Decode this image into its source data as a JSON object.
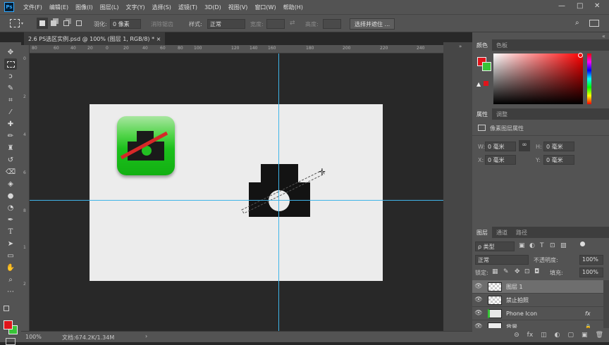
{
  "app": {
    "logo": "Ps"
  },
  "menu": [
    "文件(F)",
    "编辑(E)",
    "图像(I)",
    "图层(L)",
    "文字(Y)",
    "选择(S)",
    "滤镜(T)",
    "3D(D)",
    "视图(V)",
    "窗口(W)",
    "帮助(H)"
  ],
  "window_controls": {
    "minimize": "—",
    "maximize": "□",
    "close": "✕"
  },
  "options": {
    "feather_label": "羽化:",
    "feather_value": "0 像素",
    "antialias": "消除锯齿",
    "style_label": "样式:",
    "style_value": "正常",
    "width_label": "宽度:",
    "height_label": "高度:",
    "select_mask": "选择并遮住 ..."
  },
  "document": {
    "tab": "2.6 PS选区实例.psd @ 100% (图层 1, RGB/8) *",
    "close": "×"
  },
  "ruler_top": [
    "80",
    "60",
    "40",
    "20",
    "0",
    "20",
    "40",
    "60",
    "80",
    "100",
    "120",
    "140",
    "160",
    "180",
    "200",
    "220",
    "240"
  ],
  "ruler_left": [
    "0",
    "2",
    "4",
    "6",
    "8",
    "1",
    "2"
  ],
  "status": {
    "zoom": "100%",
    "doc": "文档:674.2K/1.34M",
    "arrow": "›"
  },
  "panels": {
    "color_tabs": [
      "颜色",
      "色板"
    ],
    "properties_tabs": [
      "属性",
      "调整"
    ],
    "properties_title": "像素图层属性",
    "w_label": "W:",
    "w_value": "0 毫米",
    "h_label": "H:",
    "h_value": "0 毫米",
    "x_label": "X:",
    "x_value": "0 毫米",
    "y_label": "Y:",
    "y_value": "0 毫米",
    "link_icon": "∞",
    "layers_tabs": [
      "图层",
      "通道",
      "路径"
    ],
    "filter_kind": "ρ 类型",
    "blend_mode": "正常",
    "opacity_label": "不透明度:",
    "opacity_value": "100%",
    "lock_label": "锁定:",
    "fill_label": "填充:",
    "fill_value": "100%",
    "layers": [
      {
        "name": "图层 1"
      },
      {
        "name": "禁止拍照"
      },
      {
        "name": "Phone Icon",
        "fx": "fx"
      },
      {
        "name": "背景",
        "lock": "🔒"
      }
    ],
    "bottom_icons": [
      "⊝",
      "fx",
      "◫",
      "◐",
      "▢",
      "▣",
      "🗑"
    ]
  },
  "colors": {
    "foreground": "#e0141b",
    "background": "#37c437",
    "accent": "#31a8ff"
  }
}
